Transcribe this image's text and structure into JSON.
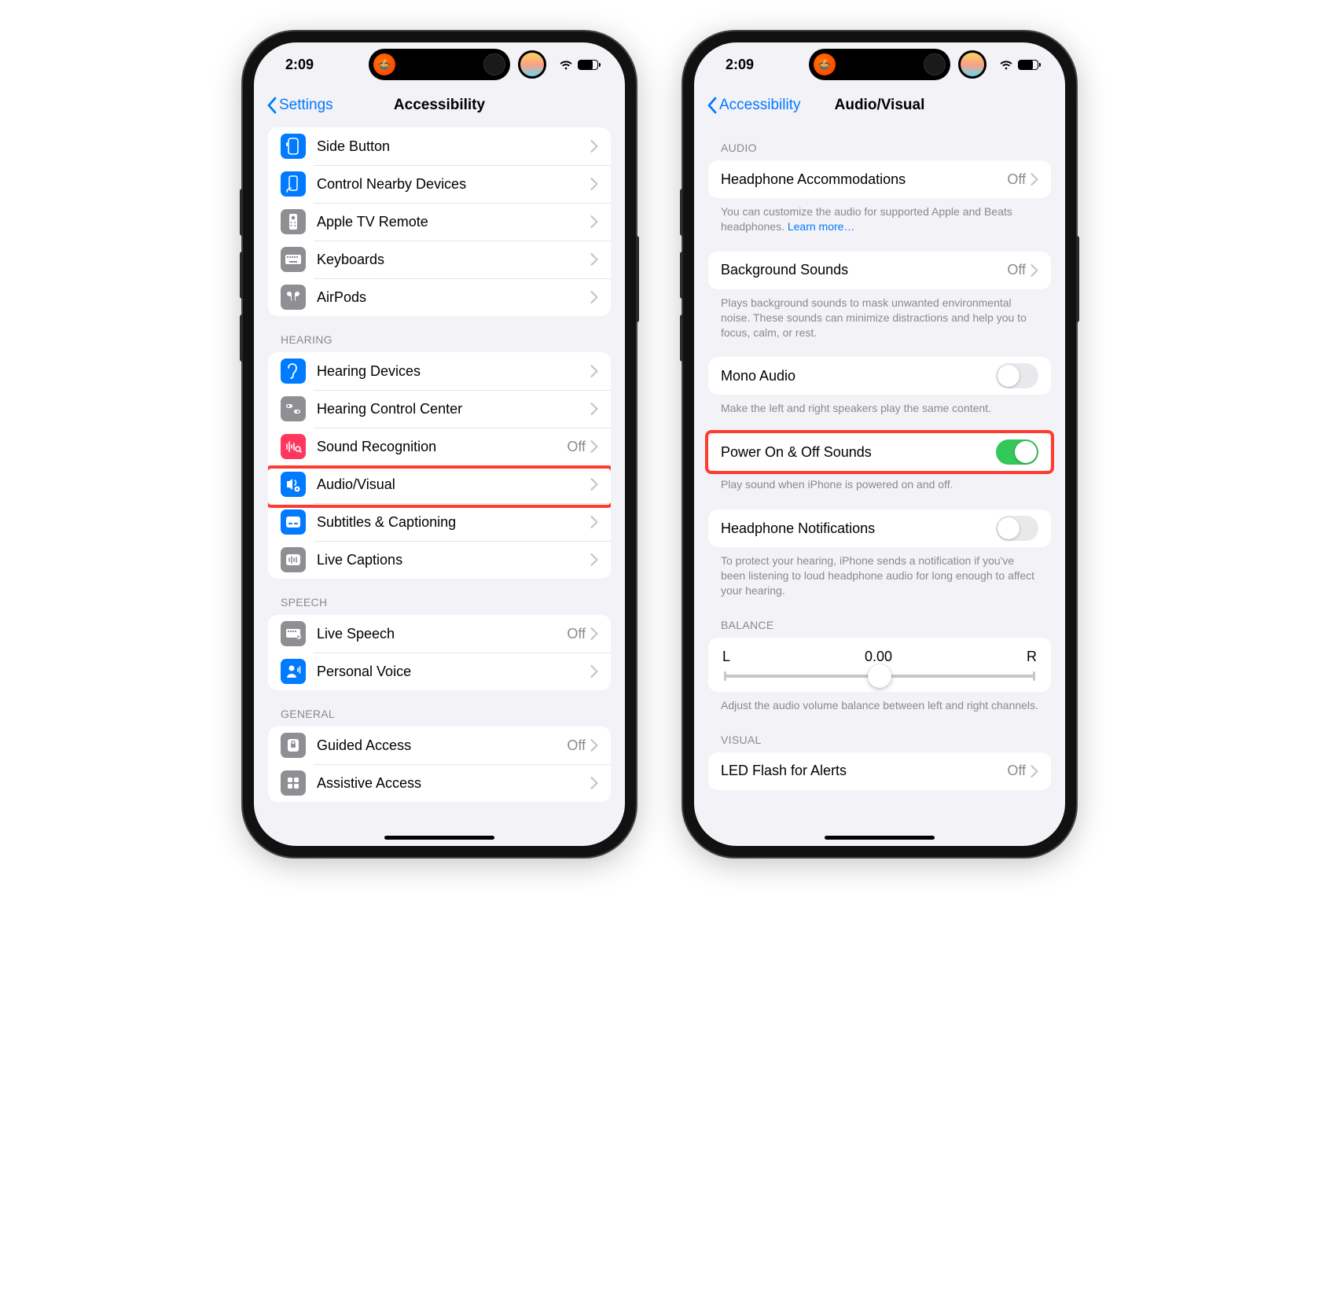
{
  "status": {
    "time": "2:09"
  },
  "left": {
    "back": "Settings",
    "title": "Accessibility",
    "groups": [
      {
        "header": null,
        "items": [
          {
            "id": "side-button",
            "label": "Side Button",
            "icon": "side-button-icon",
            "color": "blue"
          },
          {
            "id": "control-nearby",
            "label": "Control Nearby Devices",
            "icon": "nearby-icon",
            "color": "blue"
          },
          {
            "id": "apple-tv-remote",
            "label": "Apple TV Remote",
            "icon": "remote-icon",
            "color": "gray"
          },
          {
            "id": "keyboards",
            "label": "Keyboards",
            "icon": "keyboard-icon",
            "color": "gray"
          },
          {
            "id": "airpods",
            "label": "AirPods",
            "icon": "airpods-icon",
            "color": "gray"
          }
        ]
      },
      {
        "header": "HEARING",
        "items": [
          {
            "id": "hearing-devices",
            "label": "Hearing Devices",
            "icon": "ear-icon",
            "color": "blue"
          },
          {
            "id": "hearing-control",
            "label": "Hearing Control Center",
            "icon": "hearing-cc-icon",
            "color": "gray"
          },
          {
            "id": "sound-recognition",
            "label": "Sound Recognition",
            "value": "Off",
            "icon": "sound-recog-icon",
            "color": "red"
          },
          {
            "id": "audio-visual",
            "label": "Audio/Visual",
            "icon": "audio-visual-icon",
            "color": "blue",
            "highlighted": true
          },
          {
            "id": "subtitles",
            "label": "Subtitles & Captioning",
            "icon": "subtitles-icon",
            "color": "blue"
          },
          {
            "id": "live-captions",
            "label": "Live Captions",
            "icon": "live-captions-icon",
            "color": "gray"
          }
        ]
      },
      {
        "header": "SPEECH",
        "items": [
          {
            "id": "live-speech",
            "label": "Live Speech",
            "value": "Off",
            "icon": "live-speech-icon",
            "color": "gray"
          },
          {
            "id": "personal-voice",
            "label": "Personal Voice",
            "icon": "personal-voice-icon",
            "color": "blue"
          }
        ]
      },
      {
        "header": "GENERAL",
        "items": [
          {
            "id": "guided-access",
            "label": "Guided Access",
            "value": "Off",
            "icon": "guided-access-icon",
            "color": "gray"
          },
          {
            "id": "assistive-access",
            "label": "Assistive Access",
            "icon": "assistive-access-icon",
            "color": "gray"
          }
        ]
      }
    ]
  },
  "right": {
    "back": "Accessibility",
    "title": "Audio/Visual",
    "audio_header": "AUDIO",
    "headphone_accom": {
      "label": "Headphone Accommodations",
      "value": "Off"
    },
    "headphone_accom_footer_a": "You can customize the audio for supported Apple and Beats headphones. ",
    "headphone_accom_footer_link": "Learn more…",
    "background_sounds": {
      "label": "Background Sounds",
      "value": "Off"
    },
    "background_sounds_footer": "Plays background sounds to mask unwanted environmental noise. These sounds can minimize distractions and help you to focus, calm, or rest.",
    "mono_audio": {
      "label": "Mono Audio",
      "on": false
    },
    "mono_audio_footer": "Make the left and right speakers play the same content.",
    "power_sounds": {
      "label": "Power On & Off Sounds",
      "on": true,
      "highlighted": true
    },
    "power_sounds_footer": "Play sound when iPhone is powered on and off.",
    "headphone_notif": {
      "label": "Headphone Notifications",
      "on": false
    },
    "headphone_notif_footer": "To protect your hearing, iPhone sends a notification if you've been listening to loud headphone audio for long enough to affect your hearing.",
    "balance": {
      "header": "BALANCE",
      "left": "L",
      "right": "R",
      "value": "0.00",
      "footer": "Adjust the audio volume balance between left and right channels."
    },
    "visual_header": "VISUAL",
    "led_flash": {
      "label": "LED Flash for Alerts",
      "value": "Off"
    }
  }
}
